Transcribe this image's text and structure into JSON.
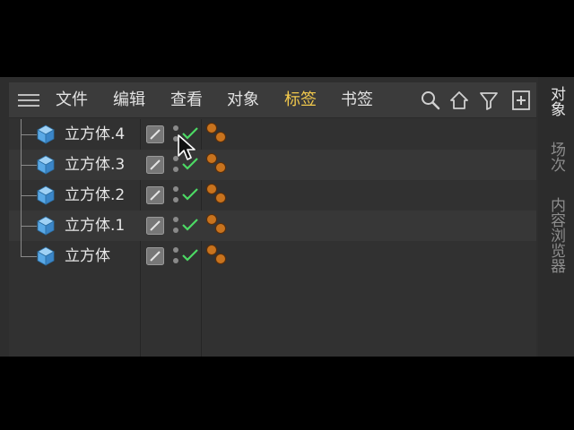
{
  "menu": {
    "items": [
      {
        "label": "文件",
        "active": false
      },
      {
        "label": "编辑",
        "active": false
      },
      {
        "label": "查看",
        "active": false
      },
      {
        "label": "对象",
        "active": false
      },
      {
        "label": "标签",
        "active": true
      },
      {
        "label": "书签",
        "active": false
      }
    ],
    "tools": [
      "search-icon",
      "home-icon",
      "filter-icon",
      "add-window-icon"
    ]
  },
  "objects": [
    {
      "name": "立方体.4",
      "icon": "cube-icon",
      "enabled": true,
      "tag": "phong-tag"
    },
    {
      "name": "立方体.3",
      "icon": "cube-icon",
      "enabled": true,
      "tag": "phong-tag"
    },
    {
      "name": "立方体.2",
      "icon": "cube-icon",
      "enabled": true,
      "tag": "phong-tag"
    },
    {
      "name": "立方体.1",
      "icon": "cube-icon",
      "enabled": true,
      "tag": "phong-tag"
    },
    {
      "name": "立方体",
      "icon": "cube-icon",
      "enabled": true,
      "tag": "phong-tag"
    }
  ],
  "side_tabs": [
    {
      "label": "对象",
      "active": true
    },
    {
      "label": "场次",
      "active": false
    },
    {
      "label": "内容浏览器",
      "active": false
    }
  ],
  "colors": {
    "accent": "#f2c94c",
    "check": "#4cd964",
    "cube": "#5aa9e6",
    "tag_ball": "#c8731e"
  }
}
